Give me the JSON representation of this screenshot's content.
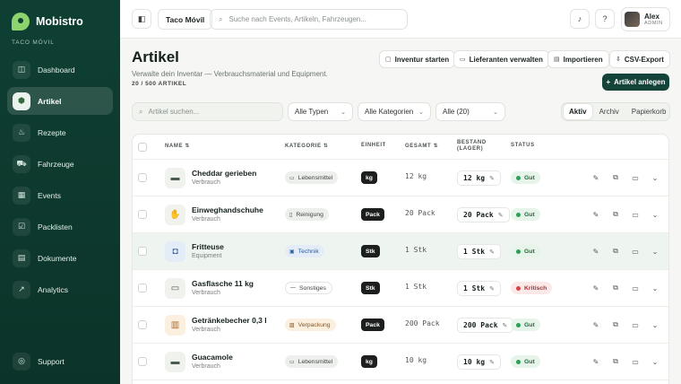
{
  "sidebar": {
    "brand": "Mobistro",
    "org": "TACO MÓVIL",
    "items": [
      {
        "label": "Dashboard",
        "icon": "dashboard-icon"
      },
      {
        "label": "Artikel",
        "icon": "box-icon",
        "active": true
      },
      {
        "label": "Rezepte",
        "icon": "recipe-icon"
      },
      {
        "label": "Fahrzeuge",
        "icon": "truck-icon"
      },
      {
        "label": "Events",
        "icon": "calendar-icon"
      },
      {
        "label": "Packlisten",
        "icon": "checklist-icon"
      },
      {
        "label": "Dokumente",
        "icon": "document-icon"
      },
      {
        "label": "Analytics",
        "icon": "chart-icon"
      }
    ],
    "support": "Support"
  },
  "topbar": {
    "tenant": "Taco Móvil",
    "search_placeholder": "Suche nach Events, Artikeln, Fahrzeugen...",
    "user_name": "Alex",
    "user_role": "ADMIN"
  },
  "header": {
    "title": "Artikel",
    "subtitle": "Verwalte dein Inventar — Verbrauchsmaterial und Equipment.",
    "count": "20 / 500 ARTIKEL",
    "actions": {
      "inventory": "Inventur starten",
      "suppliers": "Lieferanten verwalten",
      "import": "Importieren",
      "export": "CSV-Export"
    },
    "primary": "Artikel anlegen"
  },
  "filters": {
    "search_placeholder": "Artikel suchen...",
    "type": "Alle Typen",
    "category": "Alle Kategorien",
    "count": "Alle (20)",
    "tabs": [
      "Aktiv",
      "Archiv",
      "Papierkorb"
    ]
  },
  "table": {
    "headers": {
      "name": "NAME",
      "category": "KATEGORIE",
      "unit": "EINHEIT",
      "total": "GESAMT",
      "stock_line1": "BESTAND",
      "stock_line2": "(LAGER)",
      "status": "STATUS"
    },
    "rows": [
      {
        "name": "Cheddar gerieben",
        "type": "Verbrauch",
        "category": "Lebensmittel",
        "unit": "kg",
        "total": "12 kg",
        "stock": "12 kg",
        "status": "Gut"
      },
      {
        "name": "Einweghandschuhe",
        "type": "Verbrauch",
        "category": "Reinigung",
        "unit": "Pack",
        "total": "20 Pack",
        "stock": "20 Pack",
        "status": "Gut"
      },
      {
        "name": "Fritteuse",
        "type": "Equipment",
        "category": "Technik",
        "unit": "Stk",
        "total": "1 Stk",
        "stock": "1 Stk",
        "status": "Gut"
      },
      {
        "name": "Gasflasche 11 kg",
        "type": "Verbrauch",
        "category": "Sonstiges",
        "unit": "Stk",
        "total": "1 Stk",
        "stock": "1 Stk",
        "status": "Kritisch"
      },
      {
        "name": "Getränkebecher 0,3 l",
        "type": "Verbrauch",
        "category": "Verpackung",
        "unit": "Pack",
        "total": "200 Pack",
        "stock": "200 Pack",
        "status": "Gut"
      },
      {
        "name": "Guacamole",
        "type": "Verbrauch",
        "category": "Lebensmittel",
        "unit": "kg",
        "total": "10 kg",
        "stock": "10 kg",
        "status": "Gut"
      }
    ]
  },
  "colors": {
    "sidebar": "#0f3f33",
    "primary": "#14433a",
    "status_ok": "#2f9e57",
    "status_critical": "#d64545"
  }
}
